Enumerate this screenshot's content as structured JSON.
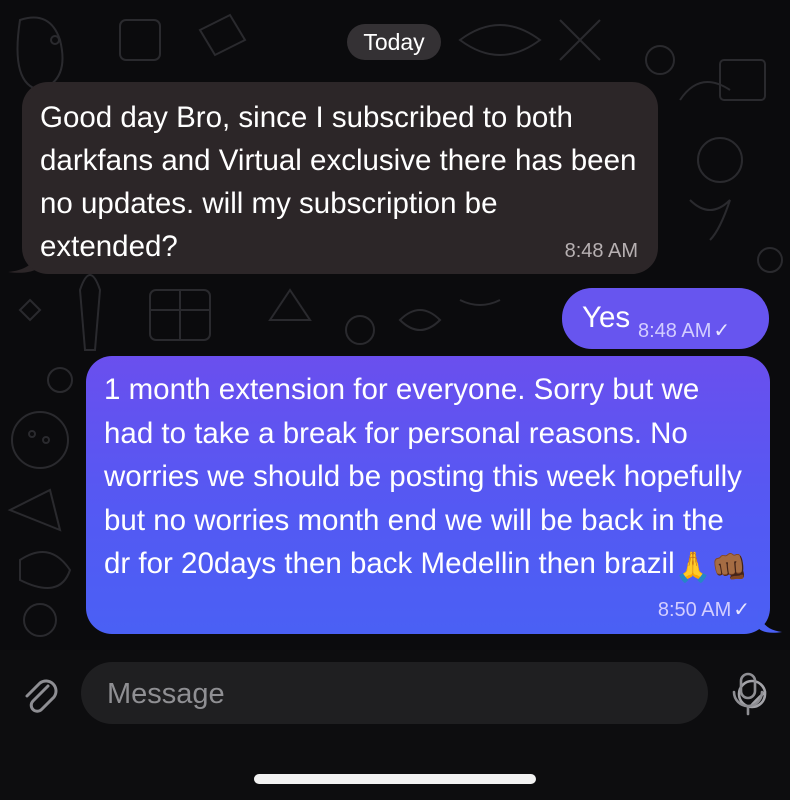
{
  "chat": {
    "date_label": "Today",
    "messages": [
      {
        "direction": "incoming",
        "text": "Good day Bro, since I subscribed to both darkfans and Virtual exclusive there has been no updates. will my subscription be extended?",
        "time": "8:48 AM"
      },
      {
        "direction": "outgoing",
        "text": "Yes",
        "time": "8:48 AM",
        "status_icon": "check-icon"
      },
      {
        "direction": "outgoing",
        "text": "1 month extension for everyone. Sorry but we had to take a break for personal reasons. No worries we should be posting this week hopefully but no worries month end we will be back in the dr for 20days then back Medellin then brazil",
        "emojis": [
          "🙏",
          "👊🏾"
        ],
        "time": "8:50 AM",
        "status_icon": "check-icon"
      }
    ]
  },
  "input_bar": {
    "placeholder": "Message",
    "icons": [
      "paperclip-icon",
      "sticker-icon",
      "microphone-icon"
    ]
  },
  "colors": {
    "background": "#0b0b0d",
    "incoming_bubble": "#2c2628",
    "outgoing_bubble_top": "#6a4fee",
    "outgoing_bubble_bottom": "#4a60f4",
    "input_field": "#1f1f21"
  }
}
